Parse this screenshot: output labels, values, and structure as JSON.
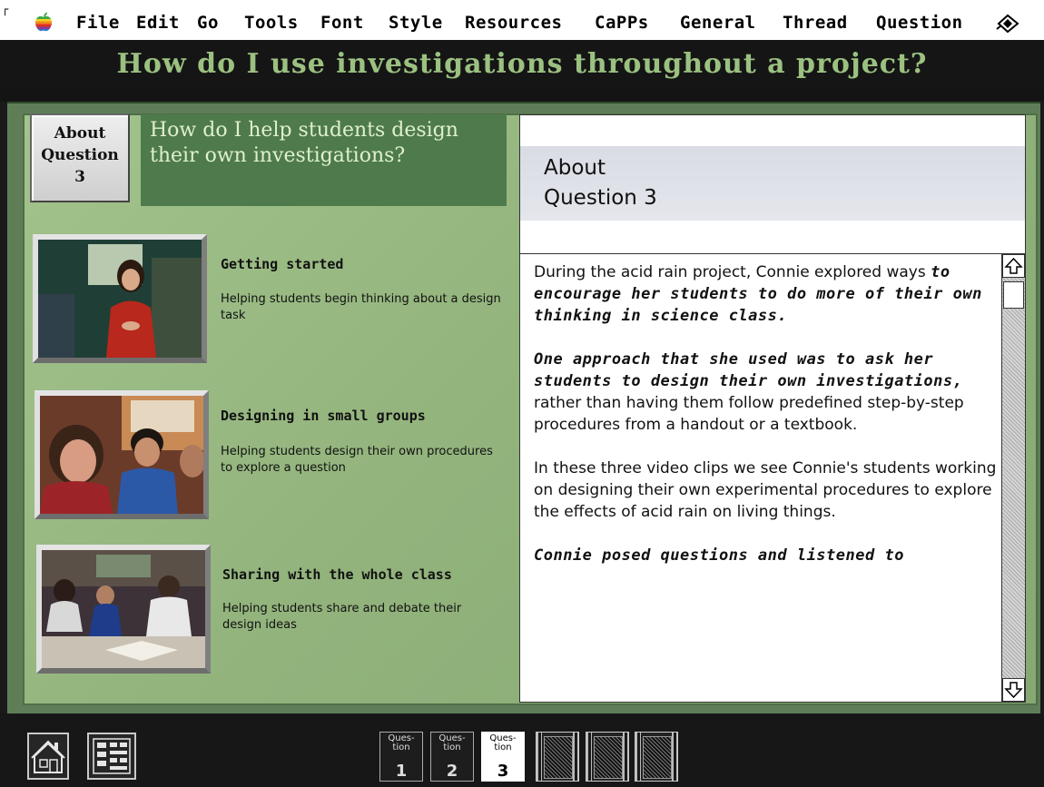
{
  "menubar": {
    "items": [
      "File",
      "Edit",
      "Go",
      "Tools",
      "Font",
      "Style",
      "Resources",
      "CaPPs",
      "General",
      "Thread",
      "Question"
    ]
  },
  "page": {
    "title": "How do I use investigations throughout a project?"
  },
  "about_button": {
    "line1": "About",
    "line2": "Question",
    "line3": "3"
  },
  "question": {
    "text": "How do I help students design their own investigations?"
  },
  "clips": [
    {
      "title": "Getting started",
      "description": "Helping students begin thinking about a design task"
    },
    {
      "title": "Designing in small groups",
      "description": "Helping students design their own procedures to explore a question"
    },
    {
      "title": "Sharing with the whole class",
      "description": "Helping students share and debate their design ideas"
    }
  ],
  "card": {
    "heading_line1": "About",
    "heading_line2": "Question 3",
    "p1_plain": "During the acid rain project, Connie explored ways ",
    "p1_emph": "to encourage her students to do more of their own thinking in science class.",
    "p2_emph": "One approach that she used was to ask her students to design their own investigations,",
    "p2_plain": " rather than having them follow predefined step-by-step procedures from a handout or a textbook.",
    "p3_plain": "In these three video clips we see Connie's students working on designing their own experimental procedures to explore the effects of acid rain on living things.",
    "p4_emph": "Connie posed questions and listened to"
  },
  "bottom_nav": {
    "question_buttons": [
      {
        "label": "Ques-tion",
        "number": "1"
      },
      {
        "label": "Ques-tion",
        "number": "2"
      },
      {
        "label": "Ques-tion",
        "number": "3"
      }
    ]
  },
  "colors": {
    "title_green": "#9bc180",
    "panel_green": "#93b47d",
    "question_box": "#4e7a4c"
  }
}
